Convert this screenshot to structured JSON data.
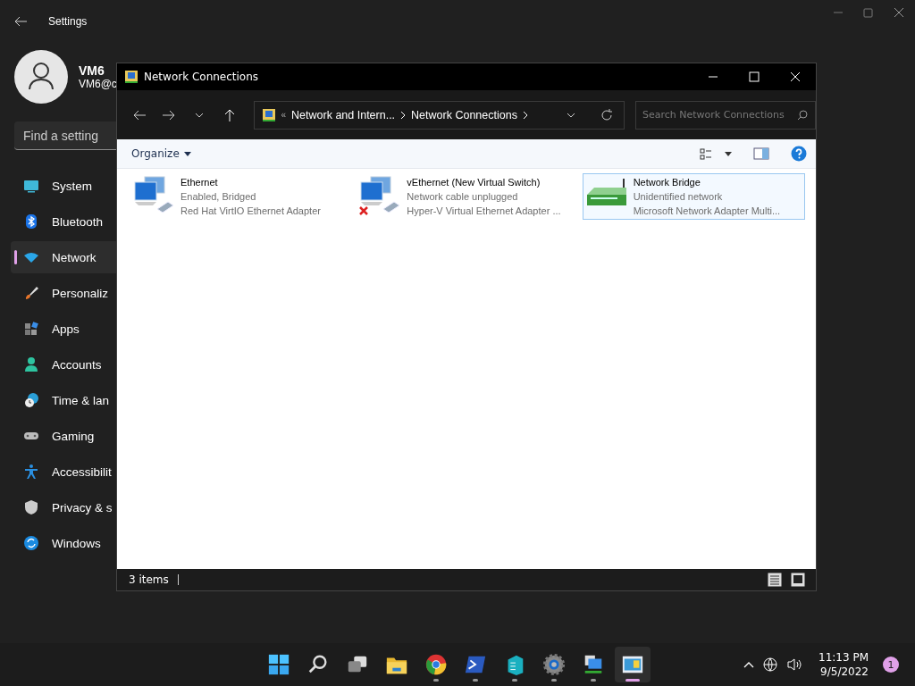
{
  "settings": {
    "title": "Settings",
    "user": {
      "name": "VM6",
      "email": "VM6@c"
    },
    "search": {
      "placeholder": "Find a setting"
    },
    "nav": [
      {
        "label": "System",
        "selected": false
      },
      {
        "label": "Bluetooth",
        "selected": false
      },
      {
        "label": "Network",
        "selected": true
      },
      {
        "label": "Personaliz",
        "selected": false
      },
      {
        "label": "Apps",
        "selected": false
      },
      {
        "label": "Accounts",
        "selected": false
      },
      {
        "label": "Time & lan",
        "selected": false
      },
      {
        "label": "Gaming",
        "selected": false
      },
      {
        "label": "Accessibilit",
        "selected": false
      },
      {
        "label": "Privacy & s",
        "selected": false
      },
      {
        "label": "Windows",
        "selected": false
      }
    ]
  },
  "explorer": {
    "title": "Network Connections",
    "address": {
      "overflow": "«",
      "segments": [
        "Network and Intern...",
        "Network Connections"
      ]
    },
    "search": {
      "placeholder": "Search Network Connections"
    },
    "organize": "Organize",
    "items": [
      {
        "name": "Ethernet",
        "status": "Enabled, Bridged",
        "device": "Red Hat VirtIO Ethernet Adapter",
        "kind": "adapter",
        "disconnected": false,
        "selected": false
      },
      {
        "name": "vEthernet (New Virtual Switch)",
        "status": "Network cable unplugged",
        "device": "Hyper-V Virtual Ethernet Adapter ...",
        "kind": "adapter",
        "disconnected": true,
        "selected": false
      },
      {
        "name": "Network Bridge",
        "status": "Unidentified network",
        "device": "Microsoft Network Adapter Multi...",
        "kind": "bridge",
        "disconnected": false,
        "selected": true
      }
    ],
    "status_bar": "3 items"
  },
  "taskbar": {
    "apps": [
      {
        "kind": "start",
        "running": false,
        "selected": false
      },
      {
        "kind": "search",
        "running": false,
        "selected": false
      },
      {
        "kind": "taskview",
        "running": false,
        "selected": false
      },
      {
        "kind": "files",
        "running": false,
        "selected": false
      },
      {
        "kind": "browser",
        "running": true,
        "selected": false
      },
      {
        "kind": "terminal",
        "running": true,
        "selected": false
      },
      {
        "kind": "server",
        "running": true,
        "selected": false
      },
      {
        "kind": "settings",
        "running": true,
        "selected": false
      },
      {
        "kind": "network",
        "running": true,
        "selected": false
      },
      {
        "kind": "control",
        "running": true,
        "selected": true
      }
    ],
    "time": "11:13 PM",
    "date": "9/5/2022",
    "notifications": "1"
  }
}
